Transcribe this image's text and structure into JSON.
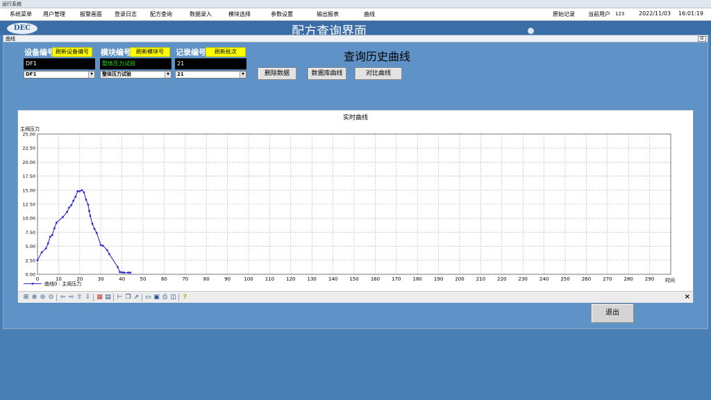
{
  "app": {
    "title": "运行系统"
  },
  "menu": {
    "items": [
      "系统菜单",
      "用户管理",
      "报警画面",
      "登录日志",
      "配方查询",
      "数据录入",
      "模块选择",
      "参数设置",
      "输出报表",
      "曲线"
    ],
    "raw_record": "原始记录",
    "current_user_label": "当前用户",
    "current_user": "123",
    "date": "2022/11/03",
    "time": "16:01:19"
  },
  "background": {
    "logo": "DEC",
    "title": "配方查询界面"
  },
  "window": {
    "title": "曲线",
    "close": "☒"
  },
  "fields": {
    "device": {
      "label": "设备编号",
      "refresh": "刷新设备编号",
      "value": "DF1",
      "select": "DF1"
    },
    "module": {
      "label": "模块编号",
      "refresh": "刷新模块号",
      "value": "整体压力试验",
      "select": "整体压力试验"
    },
    "record": {
      "label": "记录编号",
      "refresh": "刷新批次",
      "value": "21",
      "select": "21"
    }
  },
  "history": {
    "title": "查询历史曲线",
    "buttons": [
      "删除数据",
      "数据库曲线",
      "对比曲线"
    ]
  },
  "chart_data": {
    "type": "line",
    "title": "实时曲线",
    "xlabel": "时间",
    "ylabel": "主阀压力",
    "xlim": [
      0,
      300
    ],
    "ylim": [
      0,
      25
    ],
    "x_ticks": [
      "0",
      "10",
      "20",
      "30",
      "40",
      "50",
      "60",
      "70",
      "80",
      "90",
      "100",
      "110",
      "120",
      "130",
      "140",
      "150",
      "160",
      "170",
      "180",
      "190",
      "200",
      "210",
      "220",
      "230",
      "240",
      "250",
      "260",
      "270",
      "280",
      "290"
    ],
    "y_ticks": [
      "0.00",
      "2.50",
      "5.00",
      "7.50",
      "10.00",
      "12.50",
      "15.00",
      "17.50",
      "20.00",
      "22.50",
      "25.00"
    ],
    "grid": true,
    "legend": "bottom-left",
    "series": [
      {
        "name": "曲线0 : 主阀压力",
        "color": "#2b2bd6",
        "points": [
          [
            0,
            2.5
          ],
          [
            2,
            3.9
          ],
          [
            4,
            4.6
          ],
          [
            5,
            5.5
          ],
          [
            6,
            6.7
          ],
          [
            7,
            7.0
          ],
          [
            8,
            8.2
          ],
          [
            9,
            9.2
          ],
          [
            12,
            10.2
          ],
          [
            14,
            11.1
          ],
          [
            15,
            11.9
          ],
          [
            16,
            12.3
          ],
          [
            17,
            13.1
          ],
          [
            18,
            13.8
          ],
          [
            19,
            14.8
          ],
          [
            20,
            14.8
          ],
          [
            21,
            15.0
          ],
          [
            22,
            14.6
          ],
          [
            23,
            13.3
          ],
          [
            24,
            12.4
          ],
          [
            24.5,
            11.3
          ],
          [
            25,
            10.4
          ],
          [
            26,
            9.0
          ],
          [
            27,
            8.1
          ],
          [
            28,
            7.4
          ],
          [
            30,
            5.2
          ],
          [
            31,
            5.1
          ],
          [
            33,
            4.3
          ],
          [
            34,
            3.6
          ],
          [
            38,
            1.3
          ],
          [
            39,
            0.4
          ],
          [
            40,
            0.35
          ],
          [
            41,
            0.3
          ],
          [
            43,
            0.3
          ],
          [
            44,
            0.3
          ]
        ]
      }
    ]
  },
  "toolbar": {
    "icons": [
      "zoom-fit-icon",
      "zoom-in-icon",
      "zoom-out-icon",
      "zoom-reset-icon",
      "pan-left-icon",
      "pan-right-icon",
      "pan-up-icon",
      "pan-down-icon",
      "mark-icon",
      "table-icon",
      "cursor-icon",
      "copy-icon",
      "export-icon",
      "open-icon",
      "save-icon",
      "print-icon",
      "preview-icon",
      "help-icon"
    ],
    "close": "×"
  },
  "exit": {
    "label": "退出"
  }
}
